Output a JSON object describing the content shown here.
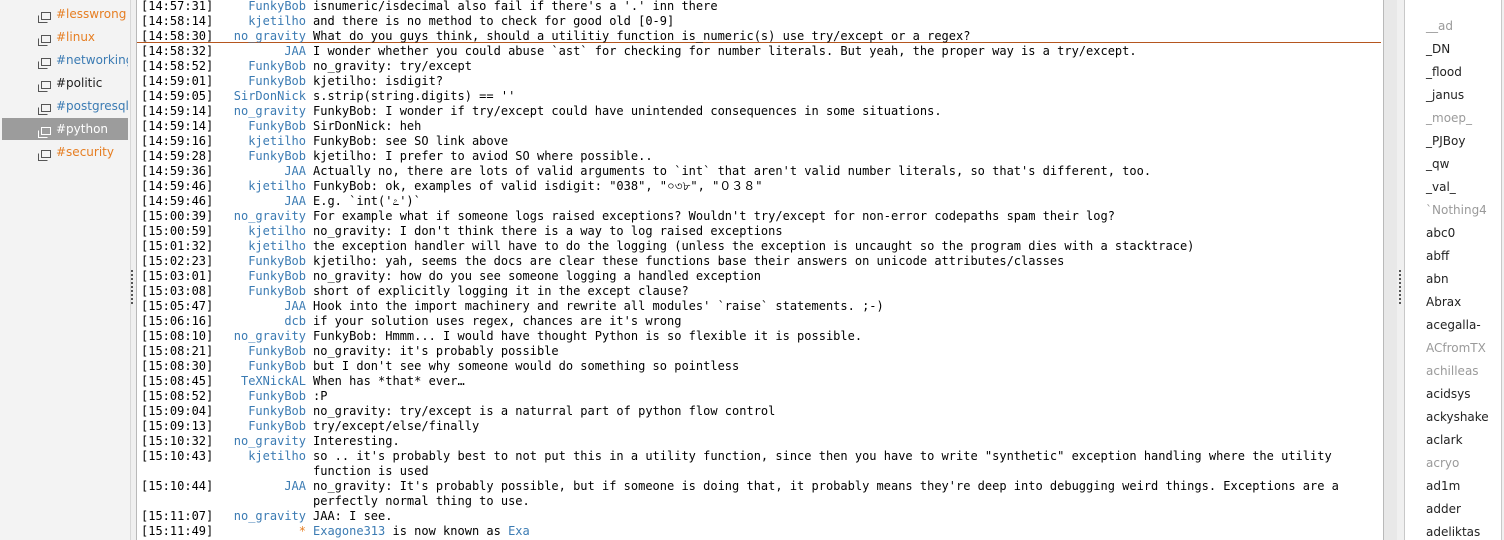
{
  "channels": [
    {
      "label": "#lesswrong",
      "color": "#e67e22",
      "active": false
    },
    {
      "label": "#linux",
      "color": "#e67e22",
      "active": false
    },
    {
      "label": "#networking",
      "color": "#3b7bb3",
      "active": false
    },
    {
      "label": "#politic",
      "color": "#222222",
      "active": false
    },
    {
      "label": "#postgresql",
      "color": "#3b7bb3",
      "active": false
    },
    {
      "label": "#python",
      "color": "#ffffff",
      "active": true
    },
    {
      "label": "#security",
      "color": "#e67e22",
      "active": false
    }
  ],
  "messages": [
    {
      "time": "[14:57:31]",
      "nick": "FunkyBob",
      "text": "isnumeric/isdecimal also fail if there's a '.' inn there"
    },
    {
      "time": "[14:58:14]",
      "nick": "kjetilho",
      "text": "and there is no method to check for good old [0-9]"
    },
    {
      "time": "[14:58:30]",
      "nick": "no_gravity",
      "text": "What do you guys think, should a utilitiy function is_numeric(s) use try/except or a regex?"
    },
    {
      "time": "[14:58:32]",
      "nick": "JAA",
      "text": "I wonder whether you could abuse `ast` for checking for number literals. But yeah, the proper way is a try/except."
    },
    {
      "time": "[14:58:52]",
      "nick": "FunkyBob",
      "text": "no_gravity: try/except"
    },
    {
      "time": "[14:59:01]",
      "nick": "FunkyBob",
      "text": "kjetilho: isdigit?"
    },
    {
      "time": "[14:59:05]",
      "nick": "SirDonNick",
      "text": "s.strip(string.digits) == ''"
    },
    {
      "time": "[14:59:14]",
      "nick": "no_gravity",
      "text": "FunkyBob: I wonder if try/except could have unintended consequences in some situations."
    },
    {
      "time": "[14:59:14]",
      "nick": "FunkyBob",
      "text": "SirDonNick: heh"
    },
    {
      "time": "[14:59:16]",
      "nick": "kjetilho",
      "text": "FunkyBob: see SO link above"
    },
    {
      "time": "[14:59:28]",
      "nick": "FunkyBob",
      "text": "kjetilho: I prefer to aviod SO where possible.."
    },
    {
      "time": "[14:59:36]",
      "nick": "JAA",
      "text": "Actually no, there are lots of valid arguments to `int` that aren't valid number literals, so that's different, too."
    },
    {
      "time": "[14:59:46]",
      "nick": "kjetilho",
      "text": "FunkyBob: ok, examples of valid isdigit: \"038\", \"০৩৮\", \"０３８\""
    },
    {
      "time": "[14:59:46]",
      "nick": "JAA",
      "text": "E.g. `int('೭')`"
    },
    {
      "time": "[15:00:39]",
      "nick": "no_gravity",
      "text": "For example what if someone logs raised exceptions? Wouldn't try/except for non-error codepaths spam their log?"
    },
    {
      "time": "[15:00:59]",
      "nick": "kjetilho",
      "text": "no_gravity: I don't think there is a way to log raised exceptions"
    },
    {
      "time": "[15:01:32]",
      "nick": "kjetilho",
      "text": "the exception handler will have to do the logging (unless the exception is uncaught so the program dies with a stacktrace)"
    },
    {
      "time": "[15:02:23]",
      "nick": "FunkyBob",
      "text": "kjetilho: yah, seems the docs are clear these functions base their answers on unicode attributes/classes"
    },
    {
      "time": "[15:03:01]",
      "nick": "FunkyBob",
      "text": "no_gravity: how do you see someone logging a handled exception"
    },
    {
      "time": "[15:03:08]",
      "nick": "FunkyBob",
      "text": "short of explicitly logging it in the except clause?"
    },
    {
      "time": "[15:05:47]",
      "nick": "JAA",
      "text": "Hook into the import machinery and rewrite all modules' `raise` statements. ;-)"
    },
    {
      "time": "[15:06:16]",
      "nick": "dcb",
      "text": "if your solution uses regex, chances are it's wrong"
    },
    {
      "time": "[15:08:10]",
      "nick": "no_gravity",
      "text": "FunkyBob: Hmmm... I would have thought Python is so flexible it is possible."
    },
    {
      "time": "[15:08:21]",
      "nick": "FunkyBob",
      "text": "no_gravity: it's probably possible"
    },
    {
      "time": "[15:08:30]",
      "nick": "FunkyBob",
      "text": "but I don't see why someone would do something so pointless"
    },
    {
      "time": "[15:08:45]",
      "nick": "TeXNickAL",
      "text": "When has *that* ever…"
    },
    {
      "time": "[15:08:52]",
      "nick": "FunkyBob",
      "text": ":P"
    },
    {
      "time": "[15:09:04]",
      "nick": "FunkyBob",
      "text": "no_gravity: try/except is a naturral part of python flow control"
    },
    {
      "time": "[15:09:13]",
      "nick": "FunkyBob",
      "text": "try/except/else/finally"
    },
    {
      "time": "[15:10:32]",
      "nick": "no_gravity",
      "text": "Interesting."
    },
    {
      "time": "[15:10:43]",
      "nick": "kjetilho",
      "text": "so .. it's probably best to not put this in a utility function, since then you have to write \"synthetic\" exception handling where the utility function is used"
    },
    {
      "time": "[15:10:44]",
      "nick": "JAA",
      "text": "no_gravity: It's probably possible, but if someone is doing that, it probably means they're deep into debugging weird things. Exceptions are a perfectly normal thing to use."
    },
    {
      "time": "[15:11:07]",
      "nick": "no_gravity",
      "text": "JAA: I see."
    },
    {
      "time": "[15:11:49]",
      "nick": "*",
      "text": " is now known as ",
      "from": "Exagone313",
      "to": "Exa"
    }
  ],
  "users": [
    {
      "name": "__ad",
      "away": true
    },
    {
      "name": "_DN",
      "away": false
    },
    {
      "name": "_flood",
      "away": false
    },
    {
      "name": "_janus",
      "away": false
    },
    {
      "name": "_moep_",
      "away": true
    },
    {
      "name": "_PJBoy",
      "away": false
    },
    {
      "name": "_qw",
      "away": false
    },
    {
      "name": "_val_",
      "away": false
    },
    {
      "name": "`Nothing4",
      "away": true
    },
    {
      "name": "abc0",
      "away": false
    },
    {
      "name": "abff",
      "away": false
    },
    {
      "name": "abn",
      "away": false
    },
    {
      "name": "Abrax",
      "away": false
    },
    {
      "name": "acegalla-",
      "away": false
    },
    {
      "name": "ACfromTX",
      "away": true
    },
    {
      "name": "achilleas",
      "away": true
    },
    {
      "name": "acidsys",
      "away": false
    },
    {
      "name": "ackyshake",
      "away": false
    },
    {
      "name": "aclark",
      "away": false
    },
    {
      "name": "acryo",
      "away": true
    },
    {
      "name": "ad1m",
      "away": false
    },
    {
      "name": "adder",
      "away": false
    },
    {
      "name": "adeliktas",
      "away": false
    }
  ],
  "colors": {
    "nick": "#3b7bb3",
    "nick_action": "#e67e22",
    "marker_line": "#b5561f",
    "active_channel_bg": "#9c9c9c"
  }
}
